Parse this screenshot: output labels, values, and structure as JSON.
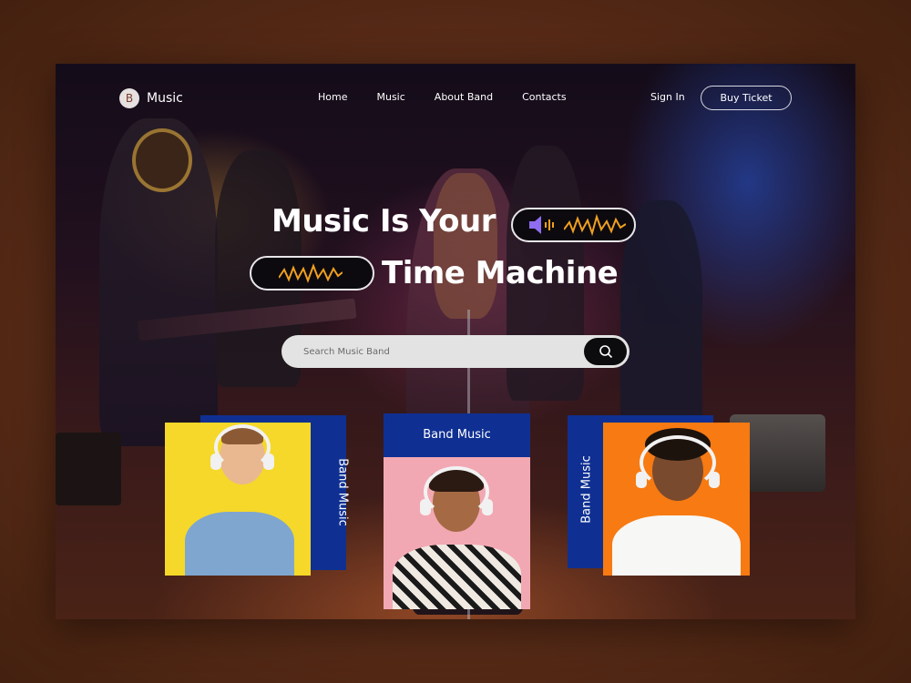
{
  "nav": {
    "logo_letter": "B",
    "logo_text": "Music",
    "menu": [
      "Home",
      "Music",
      "About Band",
      "Contacts"
    ],
    "sign_in": "Sign In",
    "buy_ticket": "Buy Ticket"
  },
  "hero": {
    "line1": "Music Is Your",
    "line2": "Time Machine",
    "pill1_icons": [
      "speaker-icon",
      "soundwave-icon"
    ],
    "pill2_icons": [
      "soundwave-icon"
    ]
  },
  "search": {
    "placeholder": "Search Music Band",
    "button_icon": "search-icon"
  },
  "cards": [
    {
      "label": "Band Music",
      "photo_bg": "#f5d829"
    },
    {
      "label": "Band Music",
      "photo_bg": "#f2a8b3"
    },
    {
      "label": "Band Music",
      "photo_bg": "#f77a12"
    }
  ],
  "colors": {
    "accent_blue": "#0f3092",
    "wave_orange": "#f0a020",
    "speaker_purple": "#8f6df0"
  }
}
